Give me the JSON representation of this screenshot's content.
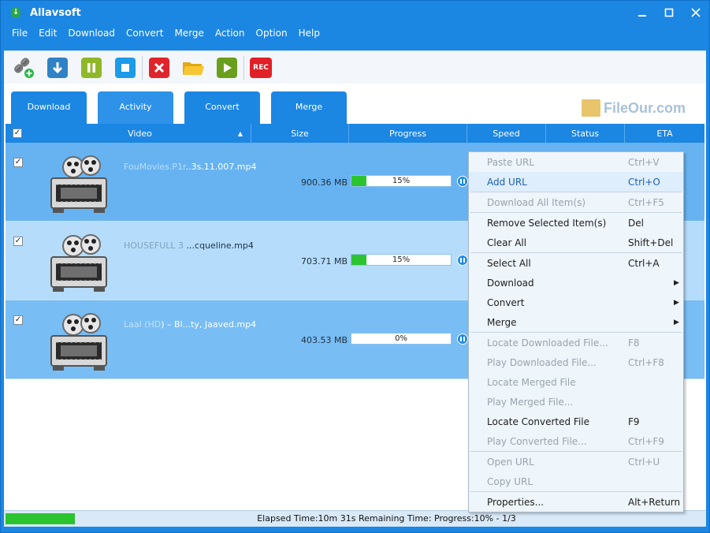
{
  "window": {
    "title": "Allavsoft"
  },
  "menu": [
    "File",
    "Edit",
    "Download",
    "Convert",
    "Merge",
    "Action",
    "Option",
    "Help"
  ],
  "toolbar": {
    "icons": [
      "add-link-icon",
      "download-icon",
      "pause-icon",
      "stop-icon",
      "delete-icon",
      "open-folder-icon",
      "play-icon",
      "record-icon"
    ],
    "rec_label": "REC"
  },
  "tabs": [
    "Download",
    "Activity",
    "Convert",
    "Merge"
  ],
  "watermark": {
    "text": "FileOur.com"
  },
  "columns": {
    "video": "Video",
    "size": "Size",
    "progress": "Progress",
    "speed": "Speed",
    "status": "Status",
    "eta": "ETA"
  },
  "rows": [
    {
      "name_blur": "FouMovies.P1r",
      "name": "..3s.11.007.mp4",
      "size": "900.36 MB",
      "progress": "15%",
      "progress_value": 0.15,
      "checked": true
    },
    {
      "name_blur": "HOUSEFULL 3 ",
      "name": "...cqueline.mp4",
      "size": "703.71 MB",
      "progress": "15%",
      "progress_value": 0.15,
      "checked": true
    },
    {
      "name_blur": "Laal (HD",
      "name": ") – Bl...ty, Jaaved.mp4",
      "size": "403.53 MB",
      "progress": "0%",
      "progress_value": 0.0,
      "checked": true
    }
  ],
  "context_menu": [
    {
      "label": "Paste URL",
      "shortcut": "Ctrl+V",
      "disabled": true
    },
    {
      "label": "Add URL",
      "shortcut": "Ctrl+O",
      "highlight": true
    },
    {
      "sep": true
    },
    {
      "label": "Download All Item(s)",
      "shortcut": "Ctrl+F5",
      "disabled": true
    },
    {
      "sep": true
    },
    {
      "label": "Remove Selected Item(s)",
      "shortcut": "Del"
    },
    {
      "label": "Clear All",
      "shortcut": "Shift+Del"
    },
    {
      "sep": true
    },
    {
      "label": "Select All",
      "shortcut": "Ctrl+A"
    },
    {
      "label": "Download",
      "submenu": true
    },
    {
      "label": "Convert",
      "submenu": true
    },
    {
      "label": "Merge",
      "submenu": true
    },
    {
      "sep": true
    },
    {
      "label": "Locate Downloaded File...",
      "shortcut": "F8",
      "disabled": true
    },
    {
      "label": "Play Downloaded File...",
      "shortcut": "Ctrl+F8",
      "disabled": true
    },
    {
      "label": "Locate Merged File",
      "disabled": true
    },
    {
      "label": "Play Merged File...",
      "disabled": true
    },
    {
      "label": "Locate Converted File",
      "shortcut": "F9"
    },
    {
      "label": "Play Converted File...",
      "shortcut": "Ctrl+F9",
      "disabled": true
    },
    {
      "sep": true
    },
    {
      "label": "Open URL",
      "shortcut": "Ctrl+U",
      "disabled": true
    },
    {
      "label": "Copy URL",
      "disabled": true
    },
    {
      "sep": true
    },
    {
      "label": "Properties...",
      "shortcut": "Alt+Return"
    }
  ],
  "statusbar": {
    "text": "Elapsed Time:10m 31s Remaining Time: Progress:10% - 1/3",
    "progress_value": 0.1
  }
}
